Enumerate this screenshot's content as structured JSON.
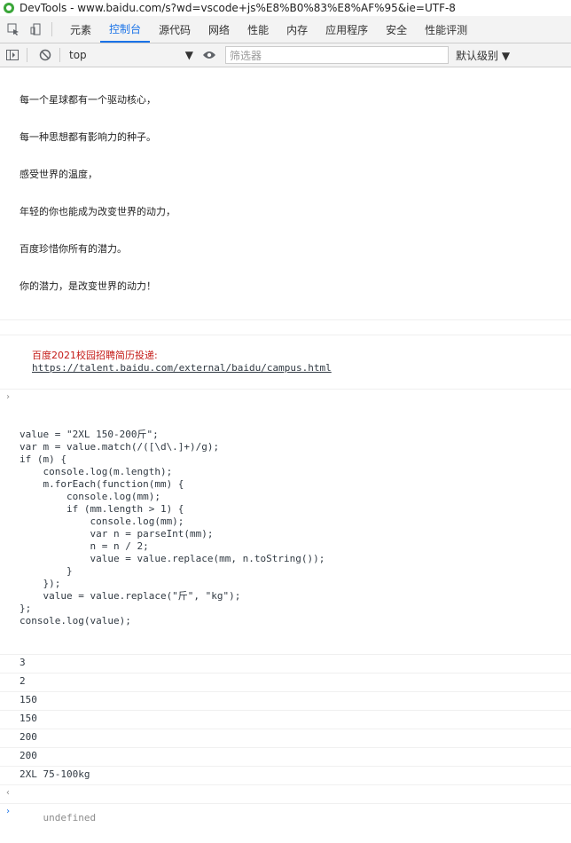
{
  "window": {
    "title": "DevTools - www.baidu.com/s?wd=vscode+js%E8%B0%83%E8%AF%95&ie=UTF-8"
  },
  "tabs": [
    "元素",
    "控制台",
    "源代码",
    "网络",
    "性能",
    "内存",
    "应用程序",
    "安全",
    "性能评测"
  ],
  "toolbar": {
    "context": "top",
    "filter_placeholder": "筛选器",
    "level": "默认级别"
  },
  "banner": [
    "每一个星球都有一个驱动核心，",
    "每一种思想都有影响力的种子。",
    "感受世界的温度，",
    "年轻的你也能成为改变世界的动力，",
    "百度珍惜你所有的潜力。",
    "你的潜力，是改变世界的动力！"
  ],
  "recruit": {
    "text": "百度2021校园招聘简历投递:",
    "link": "https://talent.baidu.com/external/baidu/campus.html"
  },
  "code_lines": [
    "value = \"2XL 150-200斤\";",
    "var m = value.match(/([\\d\\.]+)/g);",
    "if (m) {",
    "    console.log(m.length);",
    "    m.forEach(function(mm) {",
    "        console.log(mm);",
    "        if (mm.length > 1) {",
    "            console.log(mm);",
    "            var n = parseInt(mm);",
    "            n = n / 2;",
    "            value = value.replace(mm, n.toString());",
    "        }",
    "    });",
    "    value = value.replace(\"斤\", \"kg\");",
    "};",
    "console.log(value);"
  ],
  "outputs": [
    "3",
    "2",
    "150",
    "150",
    "200",
    "200",
    "2XL 75-100kg"
  ],
  "return_value": "undefined"
}
